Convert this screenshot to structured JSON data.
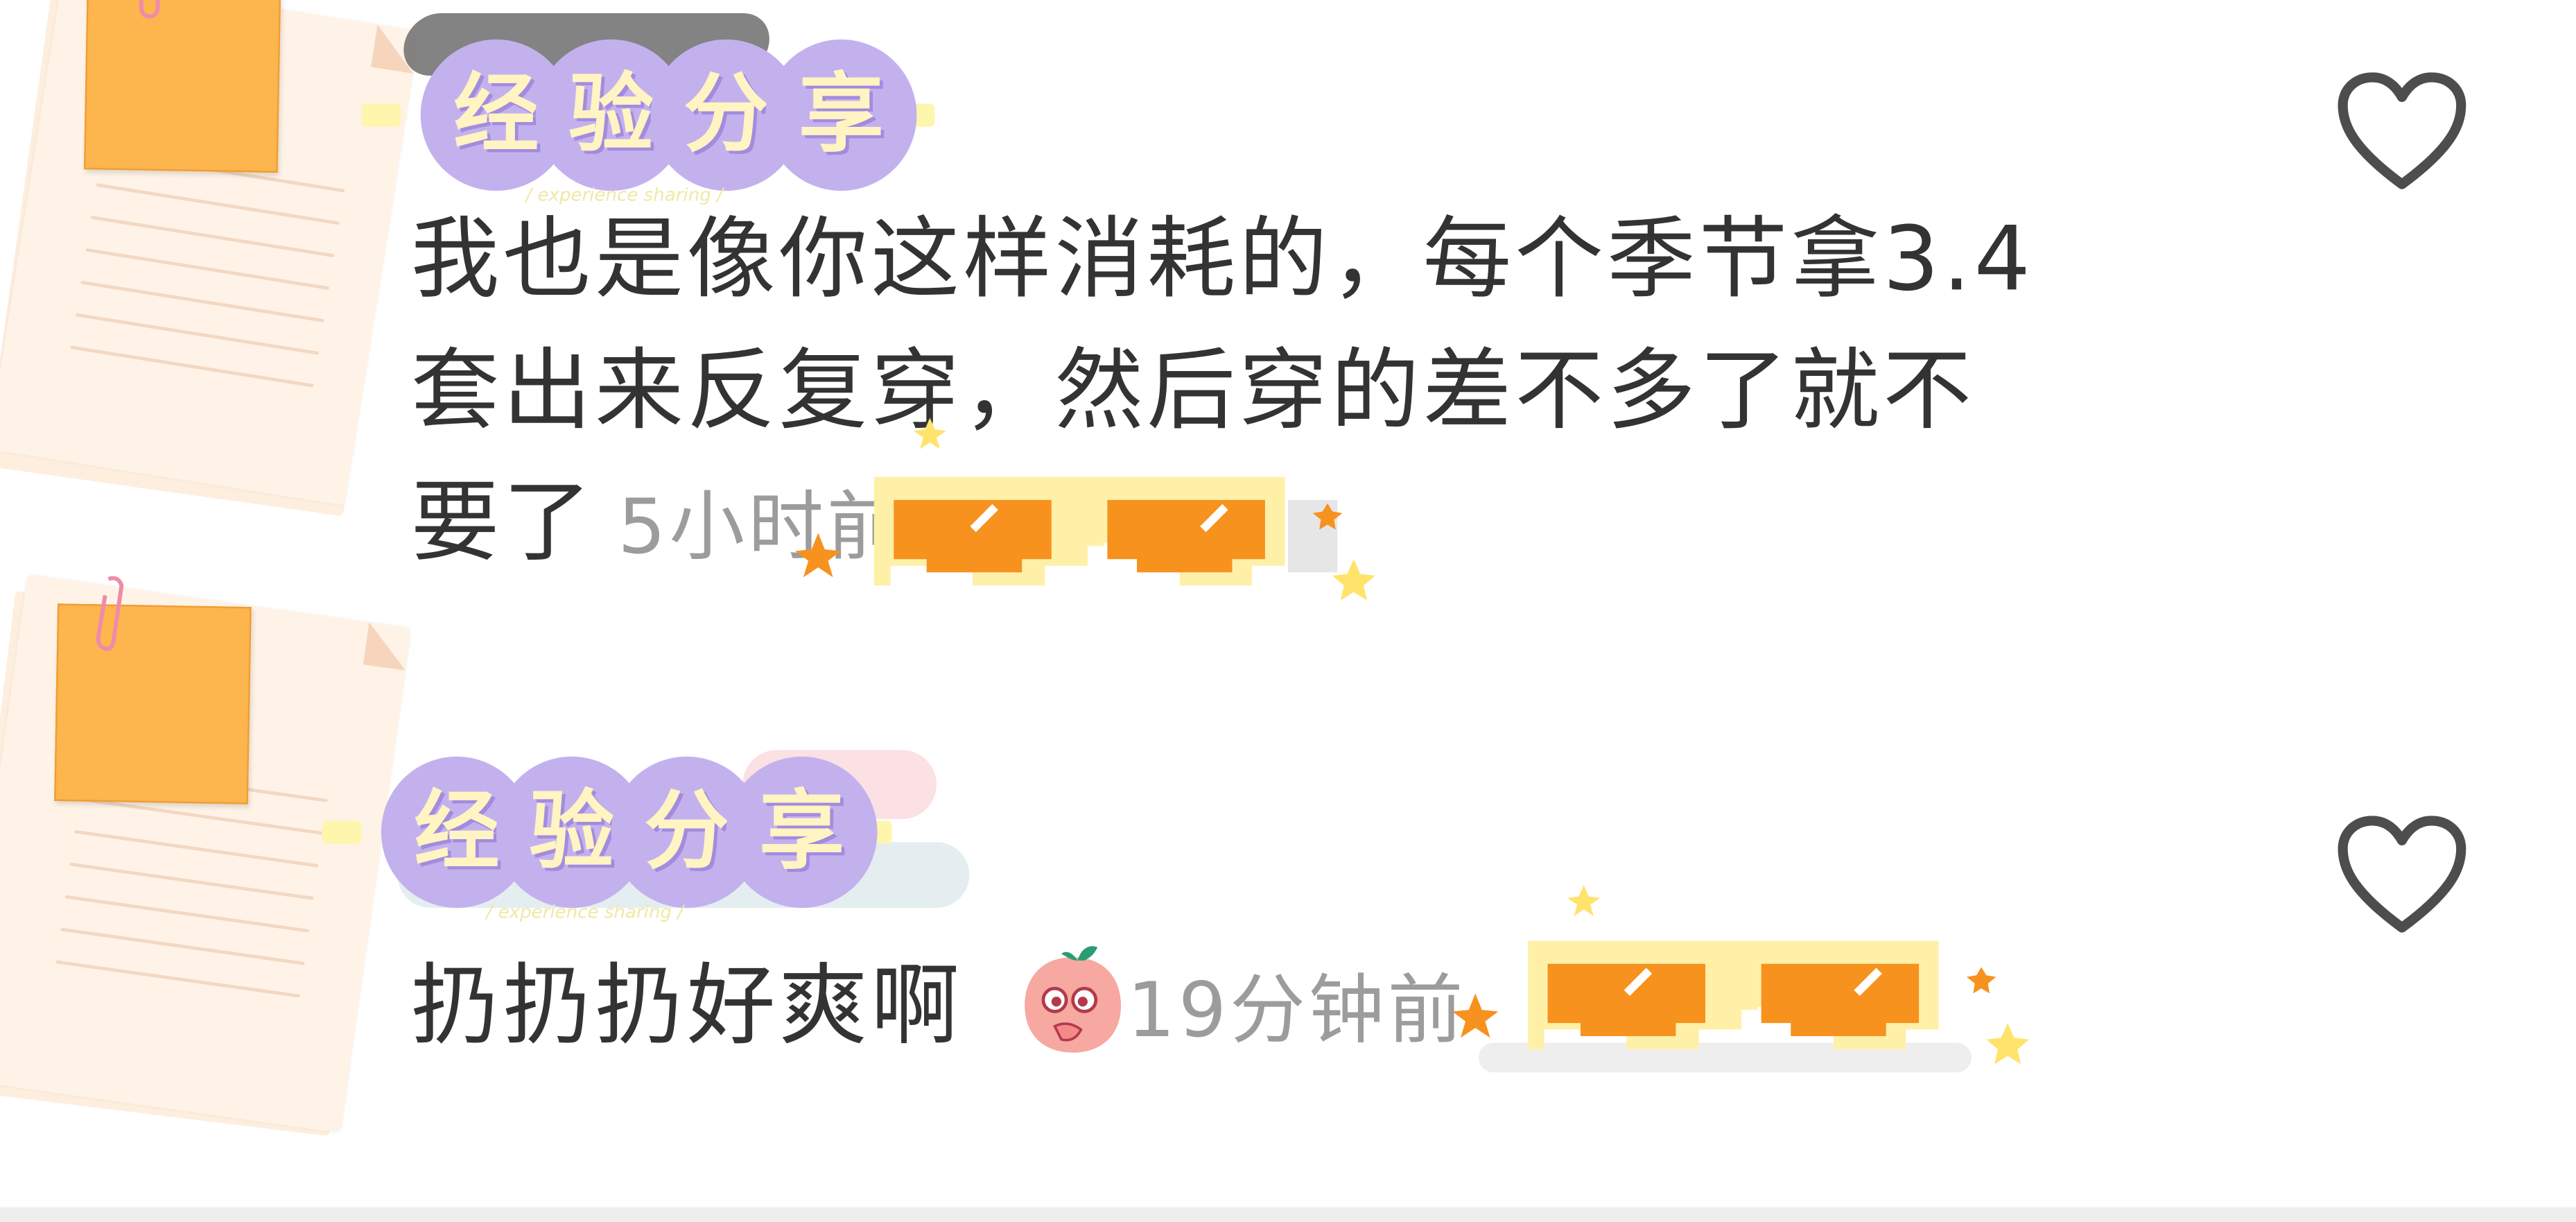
{
  "comments": [
    {
      "badge": {
        "chars": [
          "经",
          "验",
          "分",
          "享"
        ],
        "subtitle": "/ experience sharing /"
      },
      "text_lines": [
        "我也是像你这样消耗的，每个季节拿3.4",
        "套出来反复穿，然后穿的差不多了就不",
        "要了"
      ],
      "time": "5小时前",
      "like_icon": "heart-outline-icon"
    },
    {
      "badge": {
        "chars": [
          "经",
          "验",
          "分",
          "享"
        ],
        "subtitle": "/ experience sharing /"
      },
      "text_lines": [
        "扔扔扔好爽啊"
      ],
      "emoji": "blushing-face-icon",
      "time": "19分钟前",
      "like_icon": "heart-outline-icon"
    }
  ],
  "colors": {
    "badge_circle": "#c3b1ee",
    "badge_text": "#fff4c2",
    "text": "#333333",
    "time": "#9c9c9c",
    "heart": "#4d4d4d",
    "sticky_note": "#fdb54e",
    "sunglasses_lens": "#f7921e",
    "sunglasses_frame": "#ffe89a"
  }
}
